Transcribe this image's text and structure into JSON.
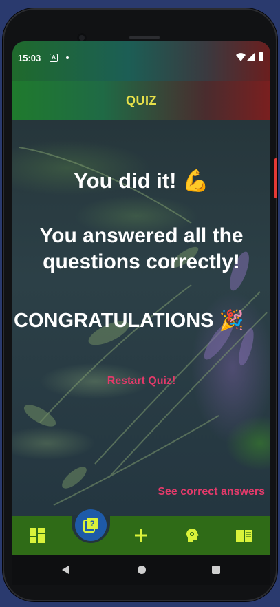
{
  "status_bar": {
    "time": "15:03",
    "notification_badge": "A"
  },
  "app_bar": {
    "title": "QUIZ"
  },
  "result": {
    "headline": "You did it! 💪",
    "message": "You answered all the questions correctly!",
    "congrats": "CONGRATULATIONS 🎉",
    "restart_label": "Restart Quiz!",
    "see_answers_label": "See correct answers"
  },
  "bottom_nav": {
    "items": [
      {
        "icon": "dashboard-icon"
      },
      {
        "icon": "quiz-icon",
        "active": true
      },
      {
        "icon": "add-icon"
      },
      {
        "icon": "brain-icon"
      },
      {
        "icon": "book-icon"
      }
    ]
  },
  "colors": {
    "appbar_title": "#e7e04a",
    "link": "#e33a6a",
    "navbar": "#2f6b17",
    "icon": "#d9f23a",
    "fab": "#1e5aa8"
  }
}
